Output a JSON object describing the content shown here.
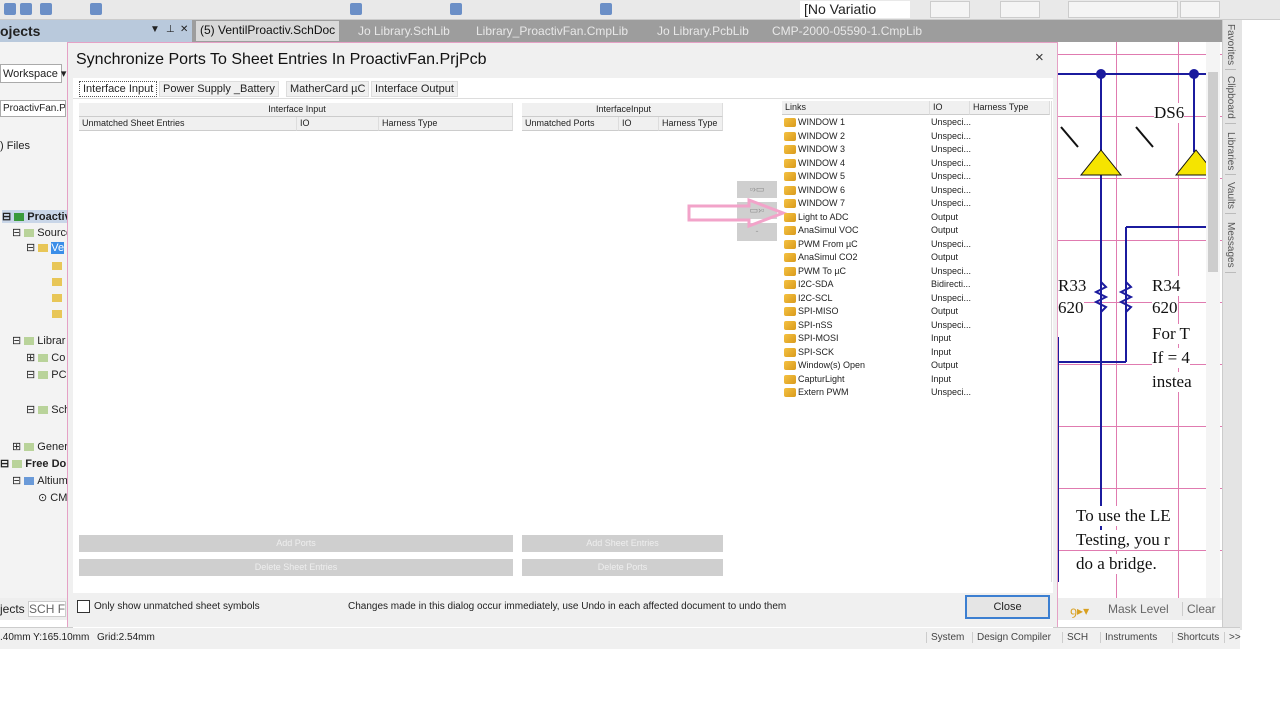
{
  "toolbar": {
    "variant": "[No Variatio"
  },
  "projects_panel": {
    "title": "ojects",
    "workspace": "Workspace",
    "project_field": "ProactivFan.Pr",
    "files_label": "Files",
    "tree": [
      "Proactiv",
      "Source",
      "Ve",
      "Librar",
      "Co",
      "PC",
      "Sch",
      "Gener",
      "Free Do",
      "Altium",
      "CM"
    ]
  },
  "doc_tabs": [
    "(5) VentilProactiv.SchDoc",
    "Jo Library.SchLib",
    "Library_ProactivFan.CmpLib",
    "Jo Library.PcbLib",
    "CMP-2000-05590-1.CmpLib"
  ],
  "right_sidebar": [
    "Favorites",
    "Clipboard",
    "Libraries",
    "Vaults",
    "Messages"
  ],
  "schematic": {
    "labels": [
      "DS6",
      "R33",
      "R34",
      "620",
      "620",
      "For T",
      "If = 4",
      "instea",
      "To use the LE",
      "Testing, you r",
      "do a bridge."
    ]
  },
  "dialog": {
    "title": "Synchronize Ports To Sheet Entries In ProactivFan.PrjPcb",
    "close": "×",
    "tabs": [
      "Interface Input",
      "Power Supply _Battery",
      "MatherCard µC",
      "Interface Output"
    ],
    "left_table": {
      "group": "Interface Input",
      "columns": [
        "Unmatched Sheet Entries",
        "IO",
        "Harness Type"
      ]
    },
    "middle_table": {
      "group": "InterfaceInput",
      "columns": [
        "Unmatched Ports",
        "IO",
        "Harness Type"
      ]
    },
    "links_table": {
      "columns": [
        "Links",
        "IO",
        "Harness Type"
      ],
      "rows": [
        {
          "name": "WINDOW 1",
          "io": "Unspeci..."
        },
        {
          "name": "WINDOW 2",
          "io": "Unspeci..."
        },
        {
          "name": "WINDOW 3",
          "io": "Unspeci..."
        },
        {
          "name": "WINDOW 4",
          "io": "Unspeci..."
        },
        {
          "name": "WINDOW 5",
          "io": "Unspeci..."
        },
        {
          "name": "WINDOW 6",
          "io": "Unspeci..."
        },
        {
          "name": "WINDOW 7",
          "io": "Unspeci..."
        },
        {
          "name": "Light to ADC",
          "io": "Output"
        },
        {
          "name": "AnaSimul VOC",
          "io": "Output"
        },
        {
          "name": "PWM From µC",
          "io": "Unspeci..."
        },
        {
          "name": "AnaSimul CO2",
          "io": "Output"
        },
        {
          "name": "PWM To µC",
          "io": "Unspeci..."
        },
        {
          "name": "I2C-SDA",
          "io": "Bidirecti..."
        },
        {
          "name": "I2C-SCL",
          "io": "Unspeci..."
        },
        {
          "name": "SPI-MISO",
          "io": "Output"
        },
        {
          "name": "SPI-nSS",
          "io": "Unspeci..."
        },
        {
          "name": "SPI-MOSI",
          "io": "Input"
        },
        {
          "name": "SPI-SCK",
          "io": "Input"
        },
        {
          "name": "Window(s) Open",
          "io": "Output"
        },
        {
          "name": "CapturLight",
          "io": "Input"
        },
        {
          "name": "Extern PWM",
          "io": "Unspeci..."
        }
      ]
    },
    "add_ports": "Add Ports",
    "add_sheet_entries": "Add Sheet Entries",
    "delete_sheet_entries": "Delete Sheet Entries",
    "delete_ports": "Delete Ports",
    "checkbox_label": "Only show unmatched sheet symbols",
    "checkbox_checked": false,
    "info": "Changes made in this dialog occur immediately, use Undo in each affected document to undo them",
    "close_button": "Close"
  },
  "bottom_tabs": {
    "projects": "jects",
    "sch": "SCH F",
    "mask_level": "Mask Level",
    "clear": "Clear"
  },
  "status": {
    "coords": ".40mm Y:165.10mm",
    "grid": "Grid:2.54mm",
    "buttons": [
      "System",
      "Design Compiler",
      "SCH",
      "Instruments",
      "Shortcuts",
      ">>"
    ]
  },
  "colors": {
    "dialog_border": "#e5a1c5",
    "arrow": "#f2a3c9",
    "wire": "#1b1b9e",
    "diode": "#f5e400",
    "grid": "#e07bb0"
  }
}
